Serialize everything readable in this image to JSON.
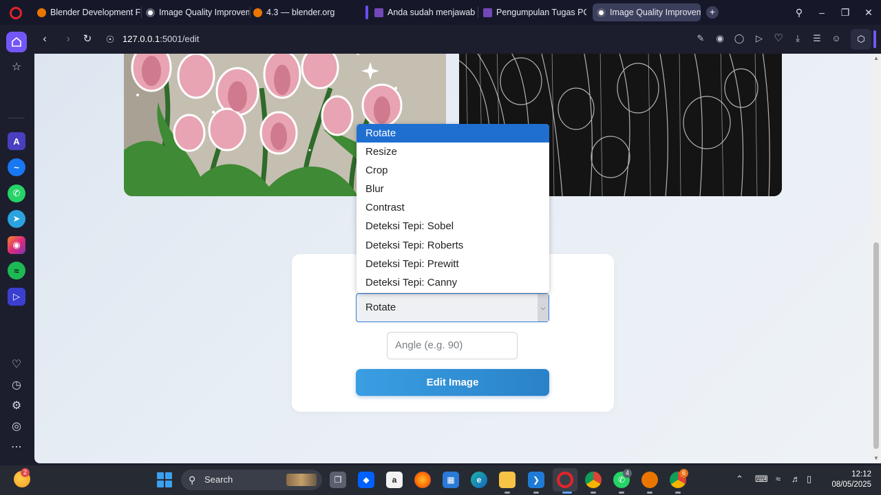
{
  "browser": {
    "tabs": [
      {
        "title": "Blender Development Fun",
        "favicon": "blender-icon",
        "color": "#ea7600"
      },
      {
        "title": "Image Quality Improveme",
        "favicon": "globe-icon",
        "color": "#c9cbd8"
      },
      {
        "title": "4.3 — blender.org",
        "favicon": "blender-icon",
        "color": "#ea7600"
      },
      {
        "title": "Anda sudah menjawab",
        "favicon": "forms-icon",
        "color": "#7248b9"
      },
      {
        "title": "Pengumpulan Tugas PCD",
        "favicon": "forms-icon",
        "color": "#7248b9"
      },
      {
        "title": "Image Quality Improveme",
        "favicon": "globe-icon",
        "color": "#c9cbd8",
        "active": true
      }
    ],
    "url": "127.0.0.1",
    "url_path": ":5001/edit"
  },
  "page": {
    "operation_options": [
      "Rotate",
      "Resize",
      "Crop",
      "Blur",
      "Contrast",
      "Deteksi Tepi: Sobel",
      "Deteksi Tepi: Roberts",
      "Deteksi Tepi: Prewitt",
      "Deteksi Tepi: Canny"
    ],
    "selected_operation": "Rotate",
    "angle_placeholder": "Angle (e.g. 90)",
    "edit_button_label": "Edit Image"
  },
  "taskbar": {
    "search_label": "Search",
    "weather_badge": "2",
    "whatsapp_badge": "4",
    "chrome_badge": "6",
    "time": "12:12",
    "date": "08/05/2025"
  },
  "colors": {
    "accent": "#7357f6",
    "select_highlight": "#1f6fd1",
    "button": "#2a82c8"
  }
}
